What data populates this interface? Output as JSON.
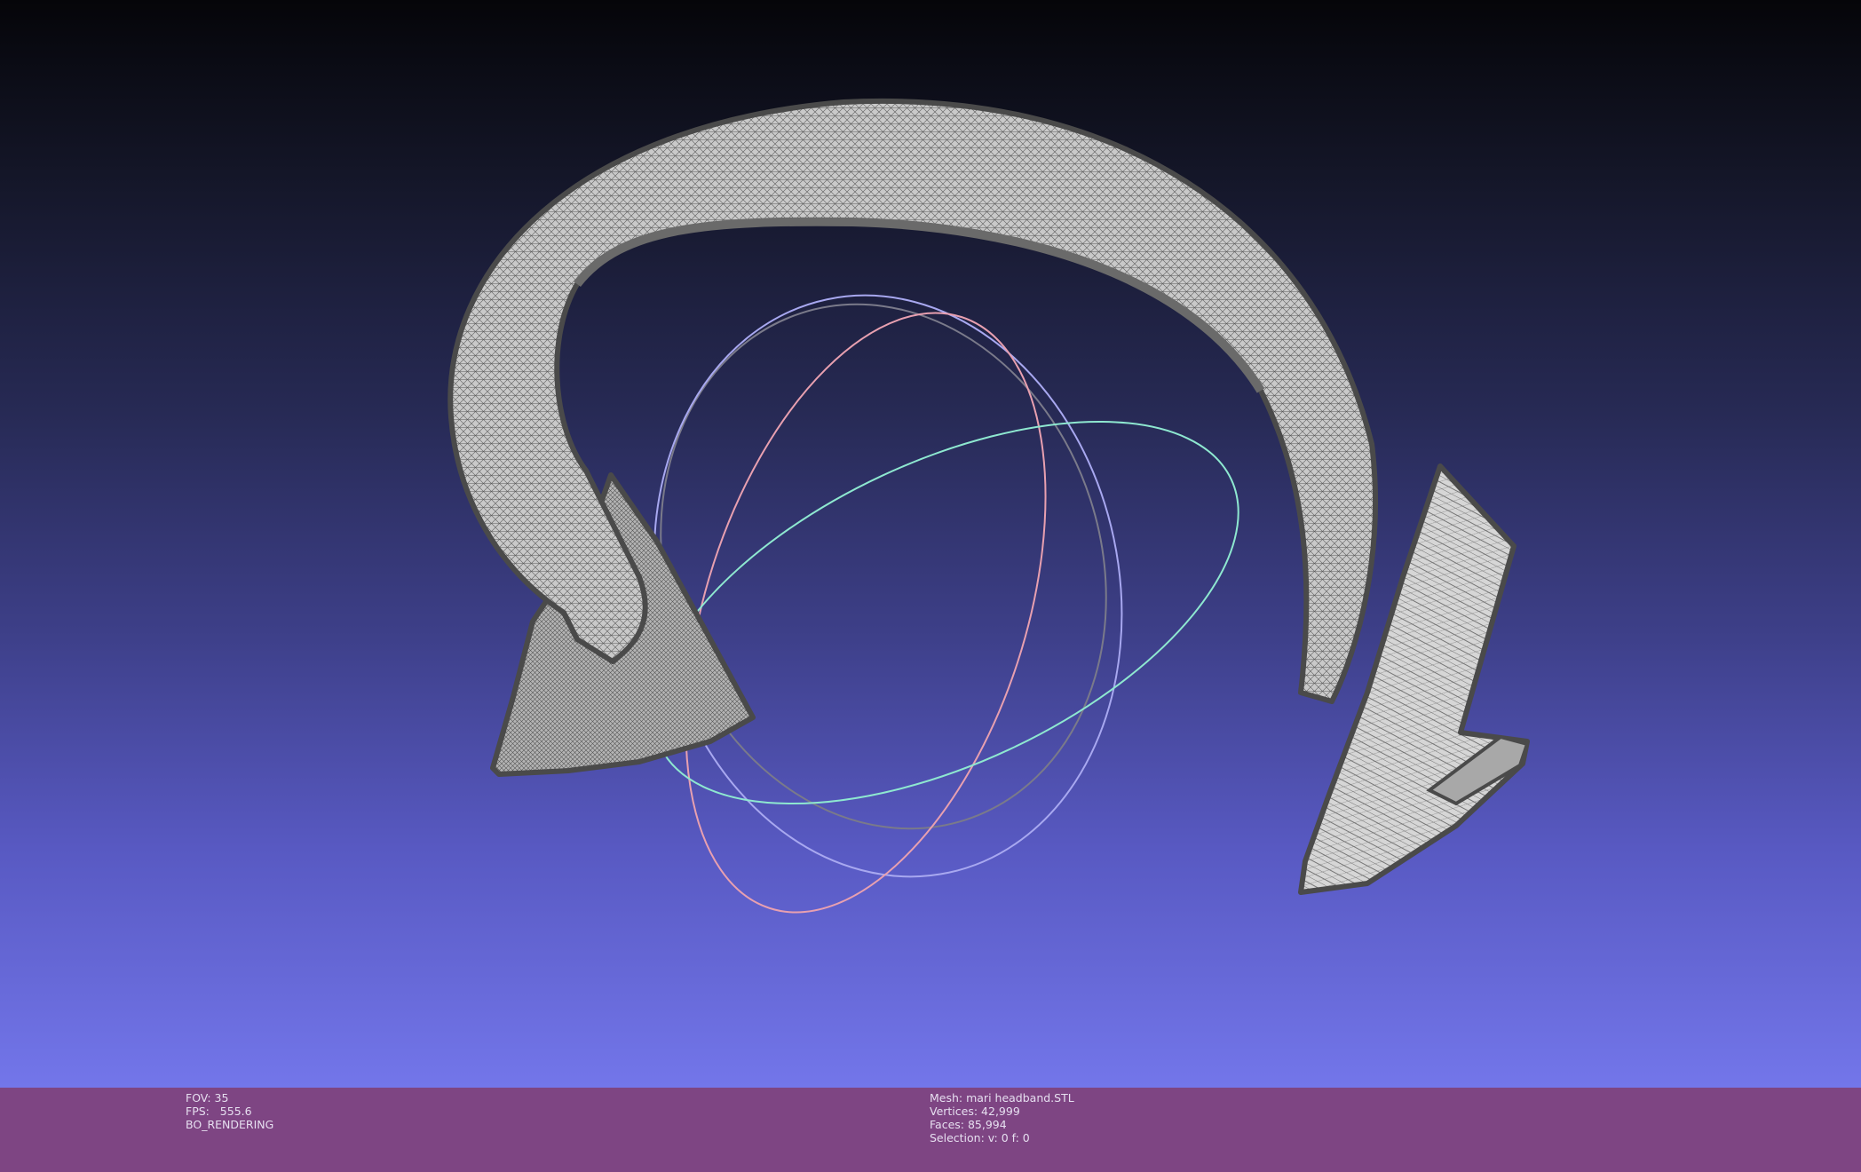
{
  "viewer": {
    "background_top": "#050509",
    "background_bottom": "#7376ea",
    "mesh_color": "#c8c8c8",
    "mesh_outline": "#4a4a4a",
    "trackball": {
      "x_ring_color": "#e8a0b0",
      "y_ring_color": "#a8a8f0",
      "z_ring_color": "#8ee8d0",
      "gray_ring_color": "#7a7a8a"
    }
  },
  "status": {
    "color": "#7e4583",
    "left": {
      "fov": "FOV: 35",
      "fps": "FPS:   555.6",
      "mode": "BO_RENDERING"
    },
    "right": {
      "mesh": "Mesh: mari headband.STL",
      "vertices": "Vertices: 42,999",
      "faces": "Faces: 85,994",
      "selection": "Selection: v: 0 f: 0"
    }
  }
}
